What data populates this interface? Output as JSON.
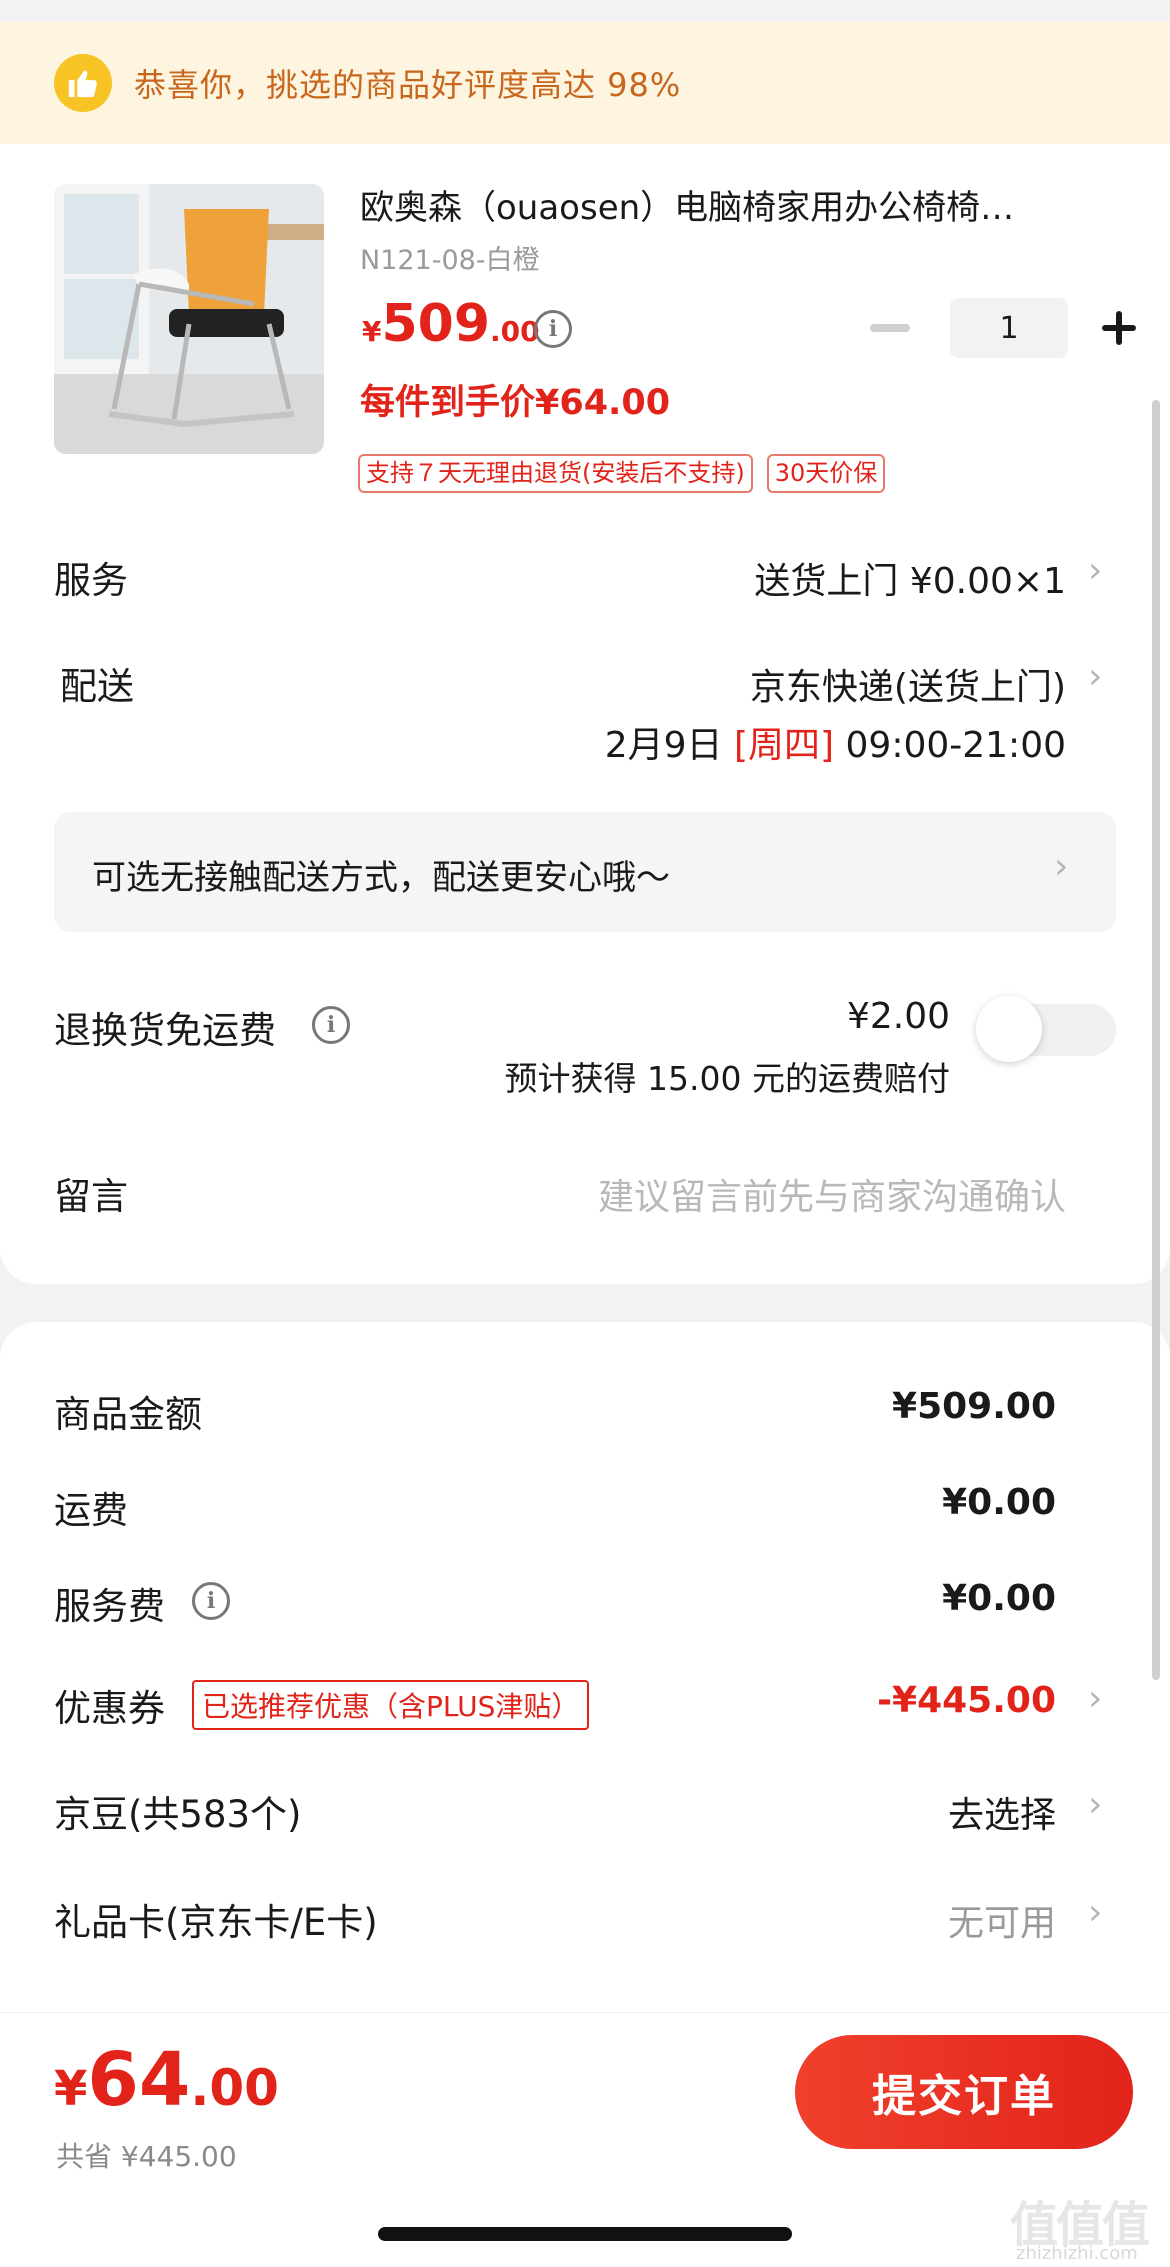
{
  "banner": {
    "text": "恭喜你，挑选的商品好评度高达 98%",
    "icon": "thumbs-up-icon"
  },
  "product": {
    "title": "欧奥森（ouaosen）电脑椅家用办公椅椅…",
    "spec": "N121-08-白橙",
    "price_symbol": "¥",
    "price_int": "509",
    "price_dec": ".00",
    "unit_price": "每件到手价¥64.00",
    "tags": [
      "支持７天无理由退货(安装后不支持)",
      "30天价保"
    ],
    "quantity": "1"
  },
  "service": {
    "label": "服务",
    "value": "送货上门  ¥0.00×1"
  },
  "delivery": {
    "label": "配送",
    "method": "京东快递(送货上门)",
    "date": "2月9日",
    "weekday": "[周四]",
    "time": "09:00-21:00"
  },
  "no_contact": {
    "text": "可选无接触配送方式，配送更安心哦～"
  },
  "return_insurance": {
    "label": "退换货免运费",
    "price": "¥2.00",
    "desc": "预计获得 15.00 元的运费赔付",
    "enabled": false
  },
  "message": {
    "label": "留言",
    "placeholder": "建议留言前先与商家沟通确认"
  },
  "summary": {
    "goods_amount_label": "商品金额",
    "goods_amount": "¥509.00",
    "shipping_label": "运费",
    "shipping": "¥0.00",
    "service_fee_label": "服务费",
    "service_fee": "¥0.00",
    "coupon_label": "优惠券",
    "coupon_tag": "已选推荐优惠（含PLUS津贴）",
    "coupon_value": "-¥445.00",
    "jingdou_label": "京豆(共583个)",
    "jingdou_value": "去选择",
    "giftcard_label": "礼品卡(京东卡/E卡)",
    "giftcard_value": "无可用"
  },
  "footer": {
    "total_symbol": "¥",
    "total_int": "64",
    "total_dec": ".00",
    "saved": "共省 ¥445.00",
    "submit_label": "提交订单"
  },
  "watermark": {
    "main": "值值值",
    "sub": "zhizhizhi.com"
  },
  "colors": {
    "accent": "#e2231a",
    "banner_bg": "#fdf5e0",
    "banner_text": "#c8661d"
  }
}
